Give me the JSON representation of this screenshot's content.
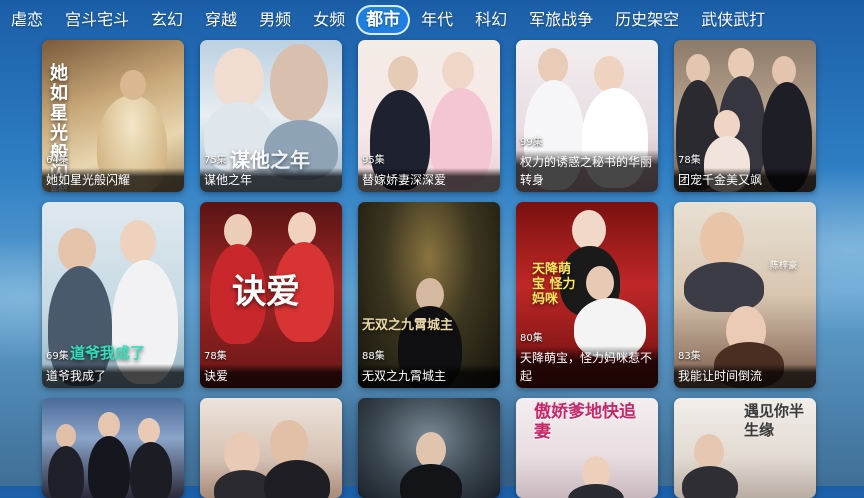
{
  "tabs": [
    {
      "label": "虐恋"
    },
    {
      "label": "宫斗宅斗"
    },
    {
      "label": "玄幻"
    },
    {
      "label": "穿越"
    },
    {
      "label": "男频"
    },
    {
      "label": "女频"
    },
    {
      "label": "都市",
      "active": true
    },
    {
      "label": "年代"
    },
    {
      "label": "科幻"
    },
    {
      "label": "军旅战争"
    },
    {
      "label": "历史架空"
    },
    {
      "label": "武侠武打"
    }
  ],
  "cards": [
    {
      "episodes": "64集",
      "title": "她如星光般闪耀",
      "poster_text": "她如星光般闪耀"
    },
    {
      "episodes": "75集",
      "title": "谋他之年",
      "poster_text": "谋他之年"
    },
    {
      "episodes": "95集",
      "title": "替嫁娇妻深深爱",
      "poster_text": ""
    },
    {
      "episodes": "99集",
      "title": "权力的诱惑之秘书的华丽转身",
      "poster_text": "权力的诱惑之秘书的华丽转身"
    },
    {
      "episodes": "78集",
      "title": "团宠千金美又飒",
      "poster_text": ""
    },
    {
      "episodes": "69集",
      "title": "道爷我成了",
      "poster_text": "道爷我成了"
    },
    {
      "episodes": "78集",
      "title": "诀爱",
      "poster_text": "诀爱"
    },
    {
      "episodes": "88集",
      "title": "无双之九霄城主",
      "poster_text": "无双之九霄城主"
    },
    {
      "episodes": "80集",
      "title": "天降萌宝，怪力妈咪惹不起",
      "poster_text": "天降萌宝 怪力妈咪"
    },
    {
      "episodes": "83集",
      "title": "我能让时间倒流",
      "poster_text": "陈梓豪"
    },
    {
      "episodes": "",
      "title": "",
      "poster_text": ""
    },
    {
      "episodes": "",
      "title": "",
      "poster_text": ""
    },
    {
      "episodes": "",
      "title": "",
      "poster_text": ""
    },
    {
      "episodes": "",
      "title": "",
      "poster_text": "傲娇爹地快追妻"
    },
    {
      "episodes": "",
      "title": "",
      "poster_text": "遇见你半生缘"
    }
  ]
}
